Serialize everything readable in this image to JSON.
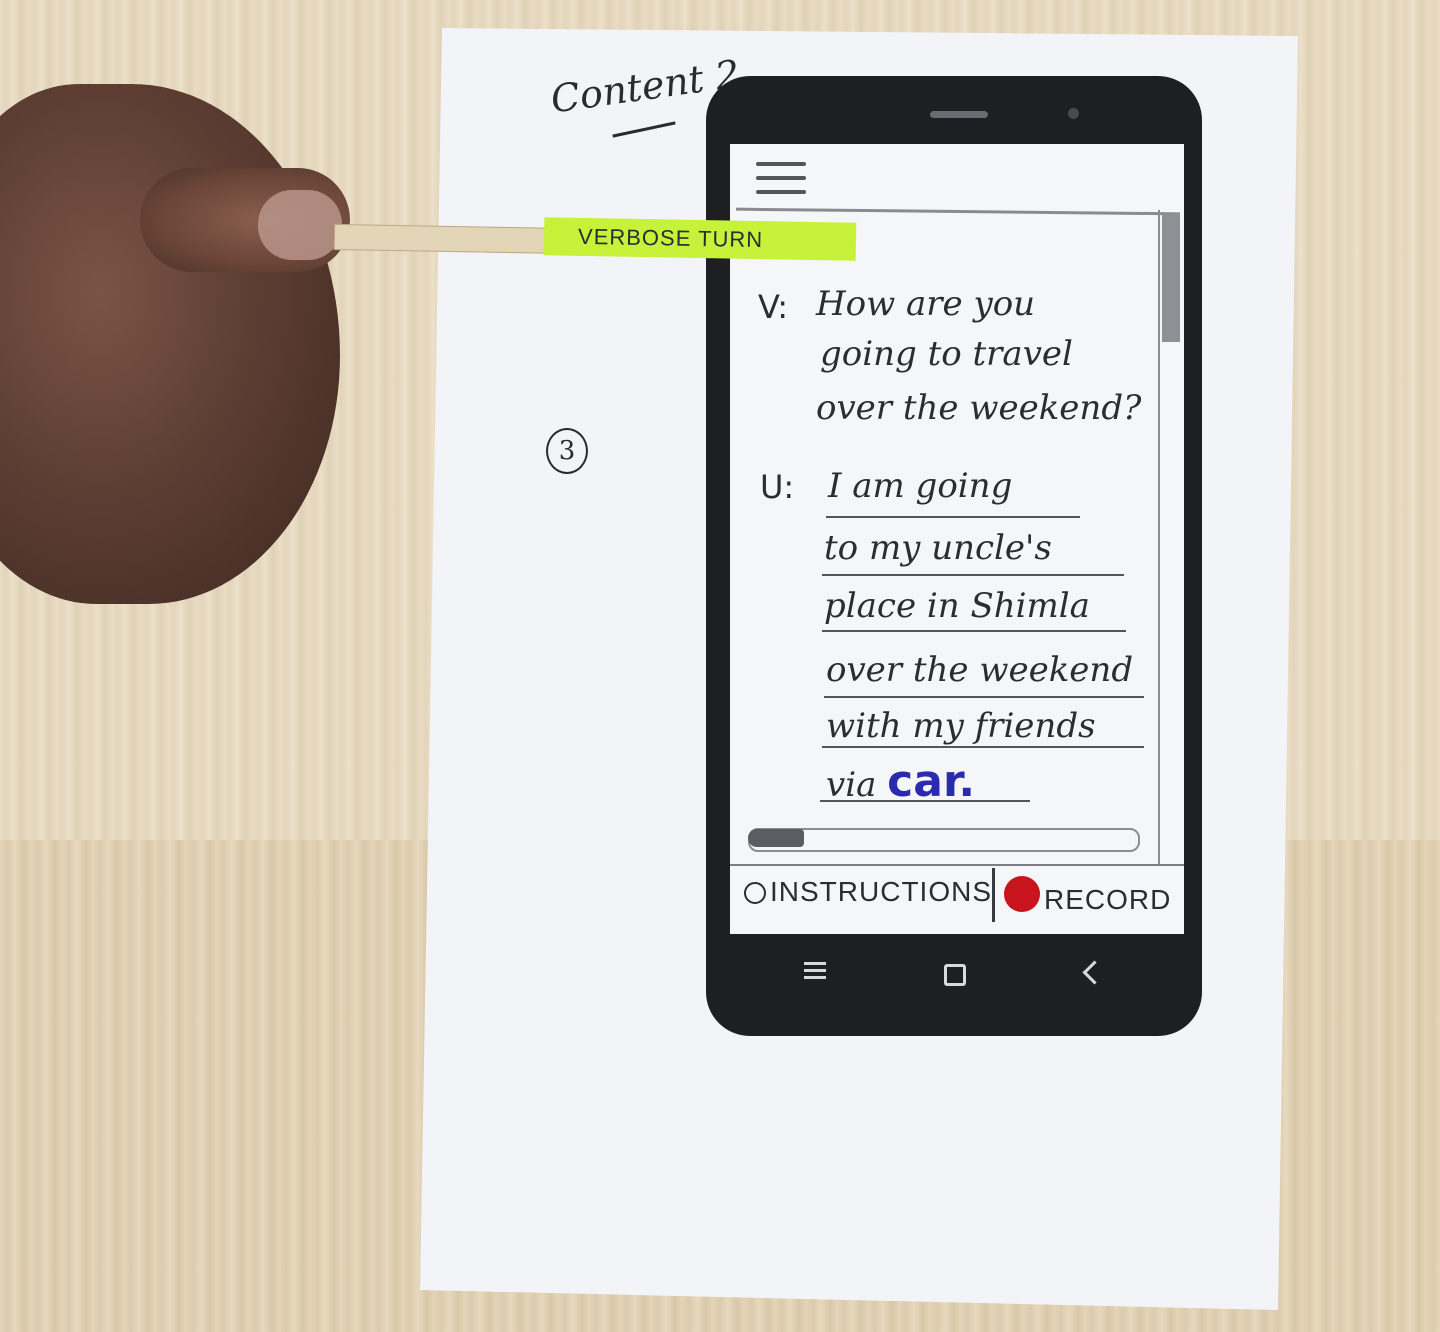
{
  "page": {
    "content_label": "Content 2",
    "page_number": "3"
  },
  "sticky_note": {
    "label": "VERBOSE TURN"
  },
  "conversation": {
    "voice_tag": "V:",
    "voice_lines": [
      "How are you",
      "going to travel",
      "over the weekend?"
    ],
    "user_tag": "U:",
    "user_lines": [
      "I am going",
      "to my uncle's",
      "place in Shimla",
      "over the weekend",
      "with my friends"
    ],
    "user_last_prefix": "via",
    "user_last_highlight": "car."
  },
  "bottom_bar": {
    "instructions_label": "INSTRUCTIONS",
    "record_label": "RECORD",
    "record_color": "#c8141c"
  },
  "icons": {
    "menu": "hamburger-menu-icon",
    "info": "info-icon",
    "record": "record-dot-icon",
    "nav_menu": "nav-menu-icon",
    "nav_home": "nav-home-icon",
    "nav_back": "nav-back-icon"
  }
}
